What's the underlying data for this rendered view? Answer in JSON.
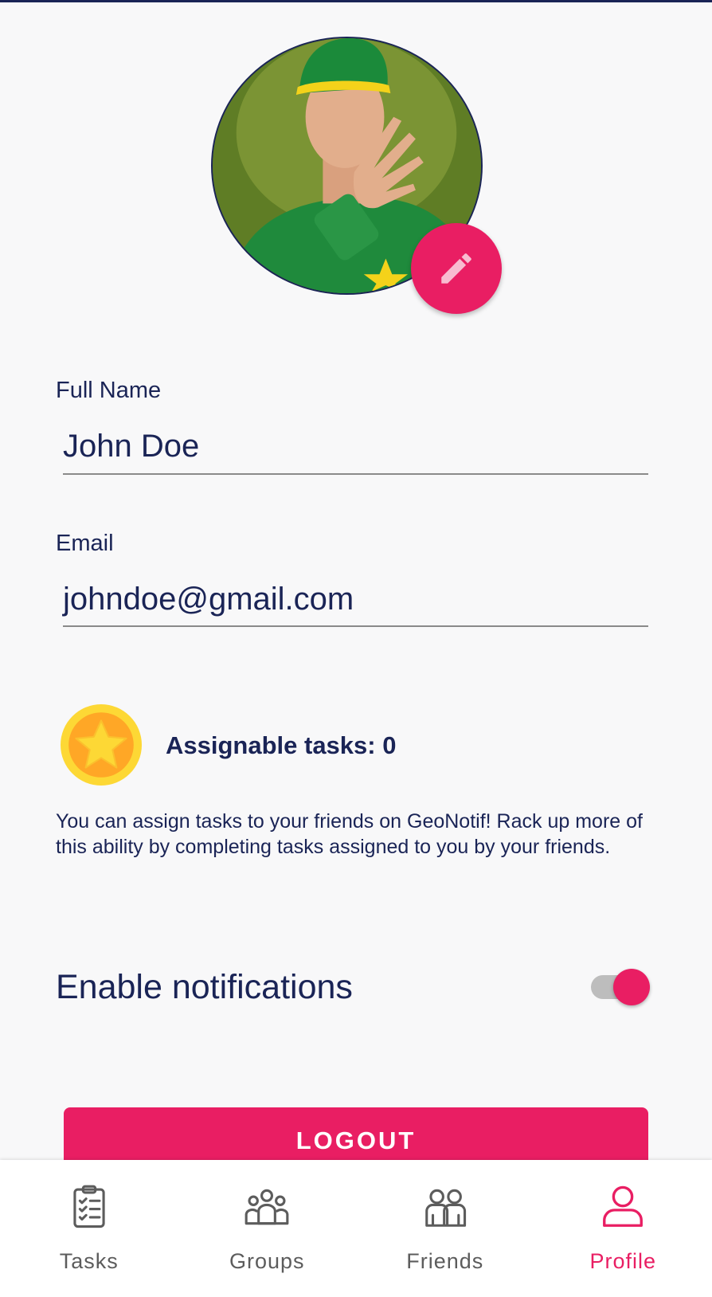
{
  "profile": {
    "avatar_alt": "Profile photo",
    "edit_icon": "pencil-icon"
  },
  "fields": {
    "name_label": "Full Name",
    "name_value": "John Doe",
    "email_label": "Email",
    "email_value": "johndoe@gmail.com"
  },
  "assignable": {
    "icon": "star-coin-icon",
    "title": "Assignable tasks: 0",
    "description": "You can assign tasks to your friends on GeoNotif! Rack up more of this ability by completing tasks assigned to you by your friends."
  },
  "notifications": {
    "label": "Enable notifications",
    "enabled": true
  },
  "logout_label": "LOGOUT",
  "nav": {
    "items": [
      {
        "label": "Tasks",
        "icon": "clipboard-list-icon",
        "active": false
      },
      {
        "label": "Groups",
        "icon": "group-icon",
        "active": false
      },
      {
        "label": "Friends",
        "icon": "friends-icon",
        "active": false
      },
      {
        "label": "Profile",
        "icon": "person-icon",
        "active": true
      }
    ]
  },
  "colors": {
    "accent": "#e91e63",
    "text": "#1a2456",
    "nav_inactive": "#5c5c5c",
    "coin_outer": "#fdd835",
    "coin_inner": "#ffa726"
  }
}
